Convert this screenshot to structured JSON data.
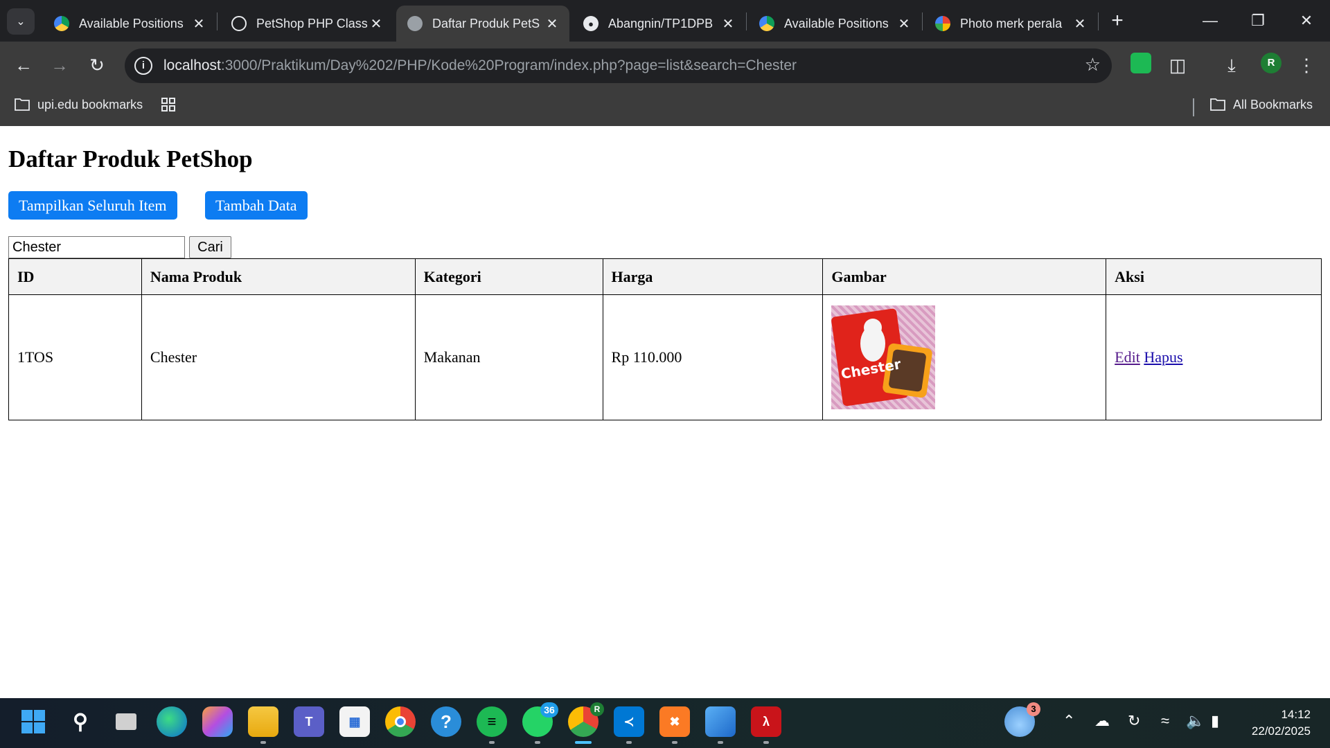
{
  "browser": {
    "tabs": [
      {
        "title": "Available Positions",
        "favicon": "google-drive-icon",
        "active": false
      },
      {
        "title": "PetShop PHP Class",
        "favicon": "openai-icon",
        "active": false
      },
      {
        "title": "Daftar Produk PetS",
        "favicon": "globe-icon",
        "active": true
      },
      {
        "title": "Abangnin/TP1DPB",
        "favicon": "github-icon",
        "active": false
      },
      {
        "title": "Available Positions",
        "favicon": "google-drive-icon",
        "active": false
      },
      {
        "title": "Photo merk perala",
        "favicon": "google-icon",
        "active": false
      }
    ],
    "address": {
      "host": "localhost",
      "path": ":3000/Praktikum/Day%202/PHP/Kode%20Program/index.php?page=list&search=Chester"
    },
    "profile_initial": "R",
    "bookmarks": {
      "folder_label": "upi.edu bookmarks",
      "all_label": "All Bookmarks"
    }
  },
  "page": {
    "title": "Daftar Produk PetShop",
    "show_all_button": "Tampilkan Seluruh Item",
    "add_button": "Tambah Data",
    "search": {
      "value": "Chester",
      "button": "Cari"
    },
    "table": {
      "headers": [
        "ID",
        "Nama Produk",
        "Kategori",
        "Harga",
        "Gambar",
        "Aksi"
      ],
      "rows": [
        {
          "id": "1TOS",
          "name": "Chester",
          "category": "Makanan",
          "price": "Rp 110.000",
          "image_label": "Chester",
          "edit": "Edit",
          "delete": "Hapus"
        }
      ]
    }
  },
  "taskbar": {
    "apps": [
      "windows-start-icon",
      "search-icon",
      "task-view-icon",
      "edge-icon",
      "copilot-icon",
      "file-explorer-icon",
      "teams-icon",
      "microsoft-store-icon",
      "chrome-icon",
      "help-icon",
      "spotify-icon",
      "whatsapp-icon",
      "chrome-profile-icon",
      "vscode-icon",
      "xampp-icon",
      "photos-icon",
      "acrobat-icon"
    ],
    "whatsapp_badge": "36",
    "chrome_profile_badge": "R",
    "weather_badge": "3",
    "time": "14:12",
    "date": "22/02/2025"
  },
  "colors": {
    "accent_button": "#0d7cf2",
    "chrome_dark": "#202124",
    "chrome_toolbar": "#3c3c3c"
  }
}
